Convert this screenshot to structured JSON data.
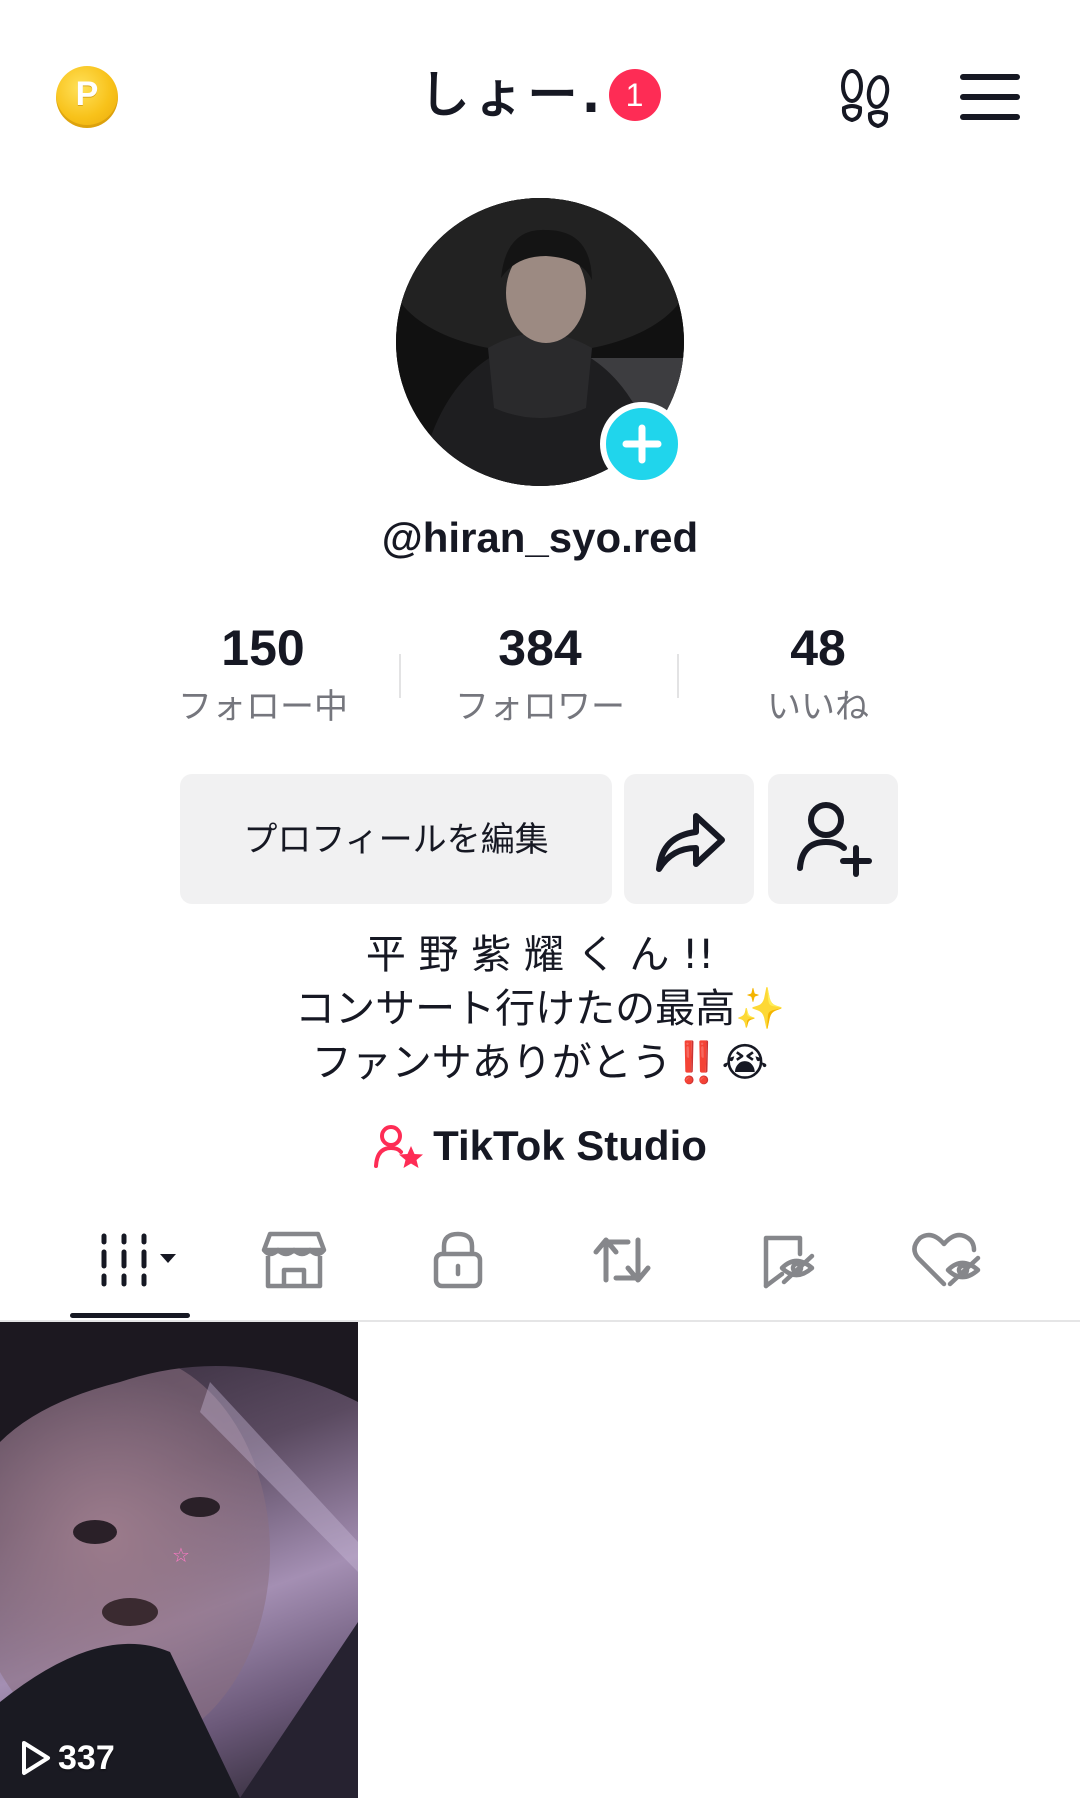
{
  "header": {
    "coin_letter": "P",
    "title": "しょー.",
    "notification_count": "1"
  },
  "profile": {
    "username": "@hiran_syo.red"
  },
  "stats": [
    {
      "value": "150",
      "label": "フォロー中"
    },
    {
      "value": "384",
      "label": "フォロワー"
    },
    {
      "value": "48",
      "label": "いいね"
    }
  ],
  "actions": {
    "edit_profile": "プロフィールを編集"
  },
  "bio": {
    "lines": [
      "平 野 紫 耀 く ん !!",
      "コンサート行けたの最高✨",
      "ファンサありがとう‼️😭"
    ]
  },
  "studio_link": "TikTok Studio",
  "tabs": [
    {
      "icon": "grid-icon",
      "selected": true
    },
    {
      "icon": "shop-icon"
    },
    {
      "icon": "lock-icon"
    },
    {
      "icon": "repost-icon"
    },
    {
      "icon": "bookmark-hidden-icon"
    },
    {
      "icon": "liked-hidden-icon"
    }
  ],
  "videos": [
    {
      "views": "337"
    }
  ],
  "colors": {
    "accent_red": "#fe2c55",
    "accent_cyan": "#20d5ec",
    "text": "#161823",
    "secondary_text": "#75767d",
    "button_bg": "#f1f1f2"
  }
}
